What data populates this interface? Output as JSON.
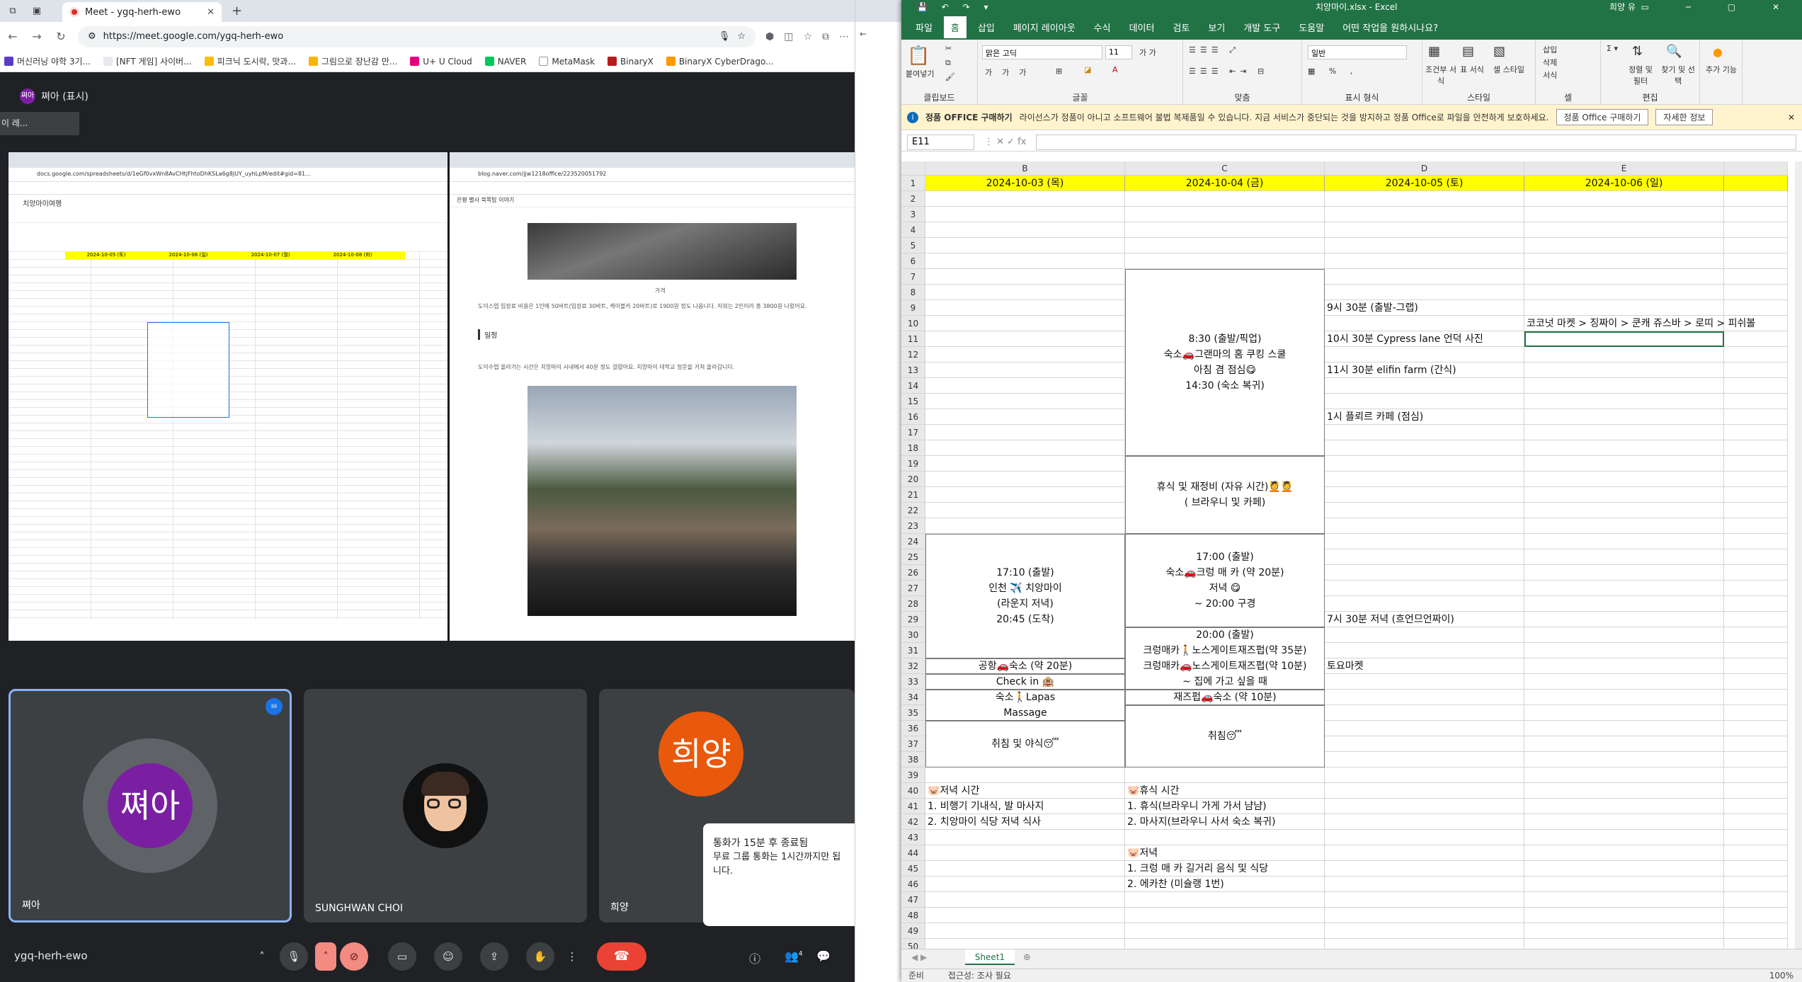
{
  "chrome": {
    "tab_title": "Meet - ygq-herh-ewo",
    "url": "https://meet.google.com/ygq-herh-ewo",
    "bookmarks": [
      "머신러닝 야학 3기...",
      "[NFT 게임] 사이버...",
      "피크닉 도시락, 맛과...",
      "그림으로 장난감 만...",
      "U+ U Cloud",
      "NAVER",
      "MetaMask",
      "BinaryX",
      "BinaryX CyberDrago..."
    ]
  },
  "meet": {
    "presenter_label": "쪄아 (표시)",
    "presenter_avatar_text": "쪄아",
    "tooltip": "이 레...",
    "shared_left": {
      "url": "docs.google.com/spreadsheets/d/1eGf0vxWn8AvCHtjFhtoDhKSLa6g8jUY_uyhLpM/edit#gid=81...",
      "title": "치앙마이여행",
      "headers": [
        "2024-10-05 (토)",
        "2024-10-06 (일)",
        "2024-10-07 (월)",
        "2024-10-08 (화)"
      ]
    },
    "shared_right": {
      "url": "blog.naver.com/jjw1218office/223520051792",
      "breadcrumb": "은평 별사 북쪽탑 이야기",
      "caption": "가격",
      "paragraph1": "도이스텝 입장료 비용은 1인에 50바트(입장료 30바트, 케이블카 20바트)로 1900원 정도 나옵니다. 저희는 2인이라 총 3800원 나왔어요.",
      "section": "일정",
      "paragraph2": "도이수텝 올라가는 시간은 치앙마이 시내에서 40분 정도 걸렸어요. 치앙마이 대학교 정문을 거쳐 올라갑니다."
    },
    "participants": [
      {
        "name": "쪄아",
        "avatar_text": "쪄아",
        "color": "#7b1fa2"
      },
      {
        "name": "SUNGHWAN CHOI",
        "avatar_text": ""
      },
      {
        "name": "희양",
        "avatar_text": "희양",
        "color": "#e8590c"
      }
    ],
    "notice": {
      "title": "통화가 15분 후 종료됨",
      "body": "무료 그룹 통화는 1시간까지만 됩니다."
    },
    "meeting_code": "ygq-herh-ewo",
    "people_count": "4"
  },
  "excel": {
    "title": "치앙마이.xlsx - Excel",
    "user": "희양 유",
    "menu": [
      "파일",
      "홈",
      "삽입",
      "페이지 레이아웃",
      "수식",
      "데이터",
      "검토",
      "보기",
      "개발 도구",
      "도움말",
      "어떤 작업을 원하시나요?"
    ],
    "ribbon": {
      "clipboard": "클립보드",
      "paste": "붙여넣기",
      "font": "글꼴",
      "font_name": "맑은 고딕",
      "font_size": "11",
      "align": "맞춤",
      "number": "표시 형식",
      "number_format": "일반",
      "styles": "스타일",
      "cond": "조건부 서식",
      "table": "표 서식",
      "cellstyle": "셀 스타일",
      "cells": "셀",
      "insert": "삽입",
      "delete": "삭제",
      "format": "서식",
      "editing": "편집",
      "sort": "정렬 및 필터",
      "find": "찾기 및 선택",
      "addins": "추가 기능"
    },
    "warning": {
      "label": "정품 OFFICE 구매하기",
      "text": "라이선스가 정품이 아니고 소프트웨어 불법 복제품일 수 있습니다. 지금 서비스가 중단되는 것을 방지하고 정품 Office로 파일을 안전하게 보호하세요.",
      "buy_button": "정품 Office 구매하기",
      "info_button": "자세한 정보"
    },
    "name_box": "E11",
    "columns": [
      "B",
      "C",
      "D",
      "E"
    ],
    "dates": [
      "2024-10-03 (목)",
      "2024-10-04 (금)",
      "2024-10-05 (토)",
      "2024-10-06 (일)"
    ],
    "merged": {
      "c_morning": [
        "8:30 (출발/픽업)",
        "숙소🚗그랜마의 홈 쿠킹 스쿨",
        "아침 겸 점심😋",
        "14:30 (숙소 복귀)"
      ],
      "c_rest": [
        "휴식 및 재정비 (자유 시간)💆💆",
        "( 브라우니 및 카페)"
      ],
      "c_evening": [
        "17:00 (출발)",
        "숙소🚗크렁 매 카 (약 20분)",
        "저녁 😋",
        "~ 20:00 구경"
      ],
      "c_night": [
        "20:00 (출발)",
        "크렁매카🚶노스게이트재즈펍(약 35분)",
        "크렁매카🚗노스게이트재즈펍(약 10분)",
        "~ 집에 가고 싶을 때"
      ],
      "c_back": "재즈펍🚗숙소 (약 10분)",
      "c_sleep": "취침😴",
      "b_flight": [
        "17:10 (출발)",
        "인천 ✈️ 치앙마이",
        "(라운지 저녁)",
        "20:45 (도착)"
      ],
      "b_airport": "공항🚗숙소 (약 20분)",
      "b_checkin": "Check in 🏨",
      "b_massage": [
        "숙소🚶Lapas",
        "Massage"
      ],
      "b_sleep": "취침 및 야식😴"
    },
    "d_items": {
      "r9": "9시 30분 (출발-그랩)",
      "r11": "10시 30분 Cypress lane 언덕 사진",
      "r13": "11시 30분 elifin farm (간식)",
      "r16": "1시 플뢰르 카페 (점심)",
      "r29": "7시 30분 저녁 (흐언므언짜이)",
      "r32": "토요마켓"
    },
    "e10": "코코넛 마켓 > 징짜이 > 쿤캐 쥬스바 > 로띠 > 피쉬볼",
    "notes_b": "🐷저녁 시간\n1. 비행기 기내식, 발 마사지\n2. 치앙마이 식당 저녁 식사",
    "notes_c": "🐷휴식 시간\n1. 휴식(브라우니 가게 가서 냠냠)\n2. 마사지(브라우니 사서 숙소 복귀)\n\n🐷저녁\n1. 크렁 매 카 길거리 음식 및 식당\n2. 에카찬 (미슐랭 1번)",
    "sheet_tab": "Sheet1",
    "status_ready": "준비",
    "status_access": "접근성: 조사 필요",
    "zoom": "100%"
  }
}
